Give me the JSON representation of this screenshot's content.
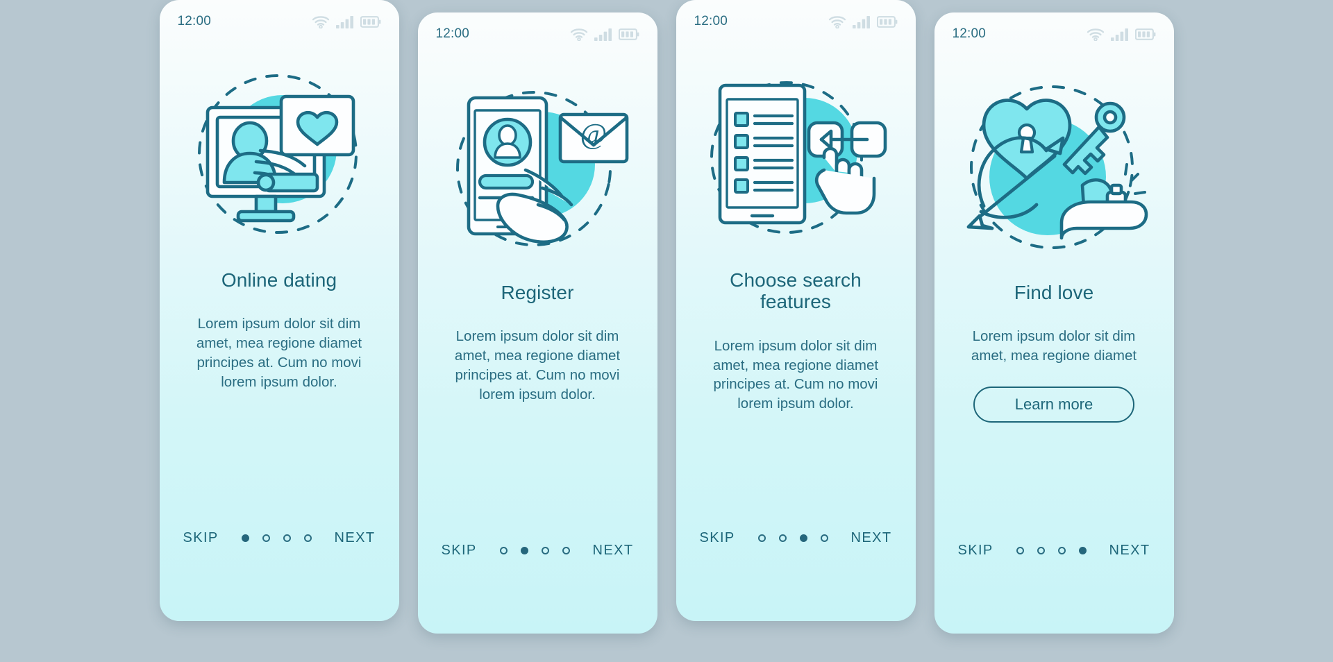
{
  "theme": {
    "background": "#b7c7d0",
    "card_gradient_top": "#fbfdfd",
    "card_gradient_bottom": "#c8f4f7",
    "accent_cyan": "#54d8e2",
    "ink_teal": "#1d6679",
    "text_teal": "#2a6d82"
  },
  "status_bar": {
    "time": "12:00",
    "icons": [
      "wifi-icon",
      "cellular-signal-icon",
      "battery-icon"
    ]
  },
  "nav": {
    "skip_label": "SKIP",
    "next_label": "NEXT",
    "total_dots": 4
  },
  "screens": [
    {
      "id": "online-dating",
      "illustration": "desktop-monitor-heart-illustration",
      "title": "Online dating",
      "body": "Lorem ipsum dolor sit dim amet, mea regione diamet principes at. Cum no movi lorem ipsum dolor.",
      "cta": null,
      "active_dot": 1
    },
    {
      "id": "register",
      "illustration": "phone-profile-email-illustration",
      "title": "Register",
      "body": "Lorem ipsum dolor sit dim amet, mea regione diamet principes at. Cum no movi lorem ipsum dolor.",
      "cta": null,
      "active_dot": 2
    },
    {
      "id": "choose-search-features",
      "illustration": "tablet-checklist-cursor-illustration",
      "title": "Choose search features",
      "body": "Lorem ipsum dolor sit dim amet, mea regione diamet principes at. Cum no movi lorem ipsum dolor.",
      "cta": null,
      "active_dot": 3
    },
    {
      "id": "find-love",
      "illustration": "heart-lock-key-bow-arrow-illustration",
      "title": "Find love",
      "body": "Lorem ipsum dolor sit dim amet, mea regione diamet",
      "cta": "Learn more",
      "active_dot": 4
    }
  ]
}
